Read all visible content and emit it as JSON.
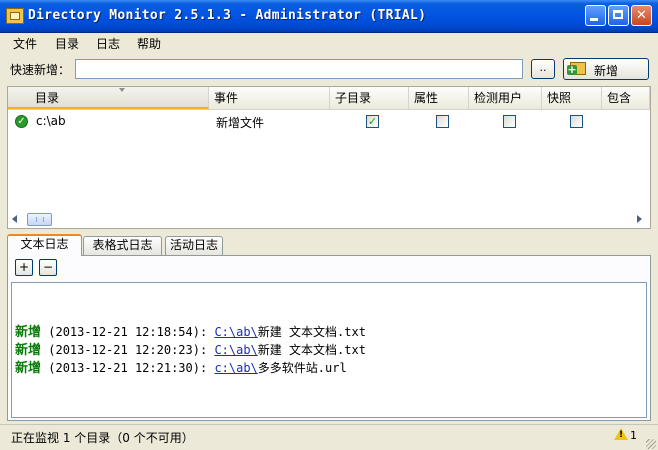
{
  "window": {
    "title": "Directory Monitor 2.5.1.3 - Administrator (TRIAL)"
  },
  "menu": [
    "文件",
    "目录",
    "日志",
    "帮助"
  ],
  "quick_add": {
    "label": "快速新增：",
    "value": "",
    "browse_label": "..",
    "add_label": "新增"
  },
  "grid": {
    "columns": [
      "目录",
      "事件",
      "子目录",
      "属性",
      "检测用户",
      "快照",
      "包含"
    ],
    "rows": [
      {
        "directory": "c:\\ab",
        "event": "新增文件",
        "subdir": true,
        "attr": false,
        "detect_user": false,
        "snapshot": false
      }
    ]
  },
  "tabs": [
    "文本日志",
    "表格式日志",
    "活动日志"
  ],
  "active_tab": "文本日志",
  "log_buttons": [
    "+",
    "−"
  ],
  "log": [
    {
      "kw": "新增",
      "time": "(2013-12-21 12:18:54):",
      "link": "C:\\ab\\",
      "file": "新建 文本文档.txt"
    },
    {
      "kw": "新增",
      "time": "(2013-12-21 12:20:23):",
      "link": "C:\\ab\\",
      "file": "新建 文本文档.txt"
    },
    {
      "kw": "新增",
      "time": "(2013-12-21 12:21:30):",
      "link": "c:\\ab\\",
      "file": "多多软件站.url"
    }
  ],
  "status": {
    "text": "正在监视 1 个目录（0 个不可用）",
    "warnings": "1"
  }
}
